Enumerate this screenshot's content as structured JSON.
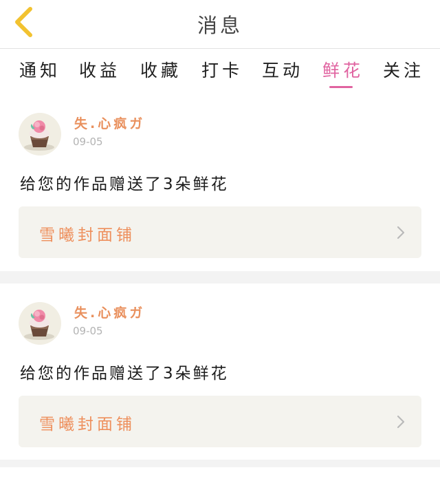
{
  "header": {
    "title": "消息",
    "back_icon": "chevron-left-icon"
  },
  "colors": {
    "accent": "#e063a0",
    "username": "#e9905d",
    "link": "#ee8f5c",
    "back_icon": "#f2c230"
  },
  "tabs": [
    {
      "label": "通知"
    },
    {
      "label": "收益"
    },
    {
      "label": "收藏"
    },
    {
      "label": "打卡"
    },
    {
      "label": "互动"
    },
    {
      "label": "鲜花",
      "active": true
    },
    {
      "label": "关注"
    }
  ],
  "messages": [
    {
      "avatar_icon": "cupcake-avatar",
      "username": "失.心疯ガ",
      "date": "09-05",
      "text": "给您的作品赠送了3朵鲜花",
      "link_label": "雪曦封面铺",
      "link_icon": "chevron-right-icon"
    },
    {
      "avatar_icon": "cupcake-avatar",
      "username": "失.心疯ガ",
      "date": "09-05",
      "text": "给您的作品赠送了3朵鲜花",
      "link_label": "雪曦封面铺",
      "link_icon": "chevron-right-icon"
    }
  ]
}
